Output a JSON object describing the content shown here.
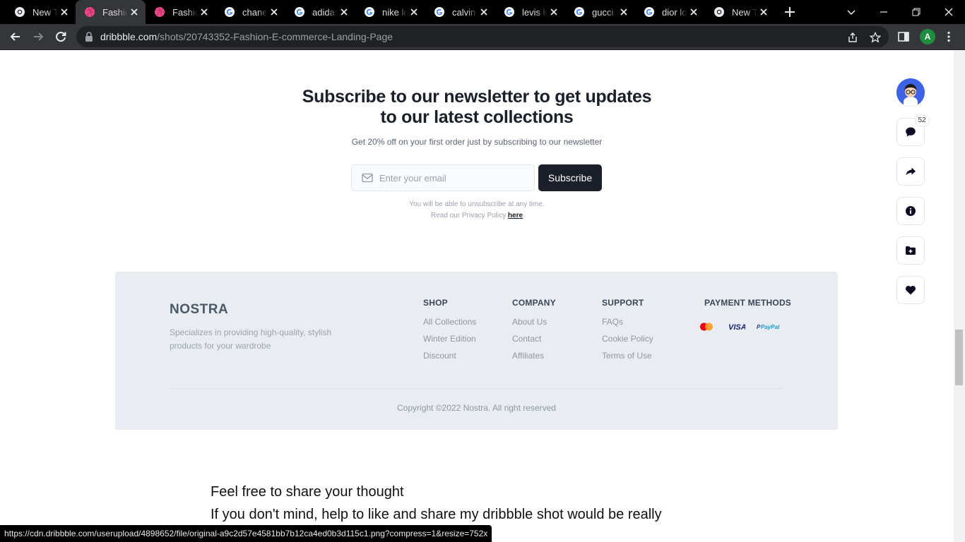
{
  "browser": {
    "tabs": [
      {
        "title": "New Tab",
        "icon": "chrome-icon"
      },
      {
        "title": "Fashion E-commerce Landing Page",
        "icon": "dribbble-icon",
        "active": true
      },
      {
        "title": "Fashion",
        "icon": "dribbble-icon"
      },
      {
        "title": "chanel",
        "icon": "google-icon"
      },
      {
        "title": "adidas",
        "icon": "google-icon"
      },
      {
        "title": "nike lo",
        "icon": "google-icon"
      },
      {
        "title": "calvin",
        "icon": "google-icon"
      },
      {
        "title": "levis lo",
        "icon": "google-icon"
      },
      {
        "title": "gucci l",
        "icon": "google-icon"
      },
      {
        "title": "dior lo",
        "icon": "google-icon"
      },
      {
        "title": "New Tab",
        "icon": "chrome-icon"
      }
    ],
    "url_host": "dribbble.com",
    "url_path": "/shots/20743352-Fashion-E-commerce-Landing-Page",
    "profile_initial": "A",
    "status_url": "https://cdn.dribbble.com/userupload/4898652/file/original-a9c2d57e4581bb7b12ca4ed0b3d115c1.png?compress=1&resize=752x"
  },
  "newsletter": {
    "title_line1": "Subscribe to our newsletter to get updates",
    "title_line2": "to our latest collections",
    "subtitle": "Get 20% off on your first order just by subscribing to our newsletter",
    "email_placeholder": "Enter your email",
    "email_value": "",
    "button_label": "Subscribe",
    "fine_line1": "You will be able to unsubscribe at any time.",
    "fine_line2": "Read our Privacy Policy",
    "fine_link": "here"
  },
  "footer": {
    "logo": "NOSTRA",
    "tagline": "Specializes in providing high-quality, stylish products for your wardrobe",
    "columns": [
      {
        "heading": "SHOP",
        "links": [
          "All Collections",
          "Winter Edition",
          "Discount"
        ]
      },
      {
        "heading": "COMPANY",
        "links": [
          "About Us",
          "Contact",
          "Affiliates"
        ]
      },
      {
        "heading": "SUPPORT",
        "links": [
          "FAQs",
          "Cookie Policy",
          "Terms of Use"
        ]
      }
    ],
    "payment_heading": "PAYMENT METHODS",
    "payment_methods": [
      "mastercard-icon",
      "visa-icon",
      "paypal-icon"
    ],
    "copyright": "Copyright ©2022 Nostra. All right reserved"
  },
  "description": {
    "line1": "Feel free to share your thought",
    "line2": "If you don't mind, help to like and share my dribbble shot would be really"
  },
  "rail": {
    "comment_count": "52",
    "buttons": [
      "comment-icon",
      "share-icon",
      "info-icon",
      "add-to-collection-icon",
      "like-heart-icon"
    ]
  },
  "colors": {
    "accent_dark": "#1a1f29",
    "footer_bg": "#e9ecf0",
    "dribbble_pink": "#ea4c89",
    "avatar_blue": "#3d63e4"
  }
}
